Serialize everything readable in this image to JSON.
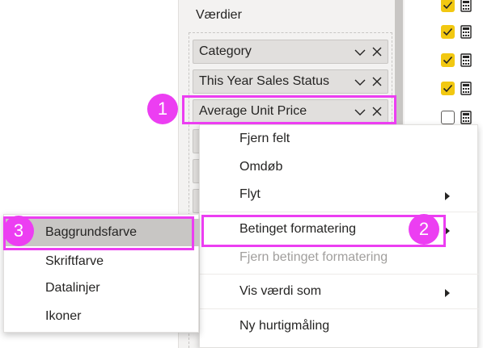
{
  "fields_pane": {
    "title": "Værdier",
    "fields": [
      {
        "label": "Category"
      },
      {
        "label": "This Year Sales Status"
      },
      {
        "label": "Average Unit Price"
      }
    ]
  },
  "context_menu": {
    "items": [
      {
        "label": "Fjern felt",
        "enabled": true,
        "submenu": false
      },
      {
        "label": "Omdøb",
        "enabled": true,
        "submenu": false
      },
      {
        "label": "Flyt",
        "enabled": true,
        "submenu": true
      },
      {
        "label": "Betinget formatering",
        "enabled": true,
        "submenu": true
      },
      {
        "label": "Fjern betinget formatering",
        "enabled": false,
        "submenu": false
      },
      {
        "label": "Vis værdi som",
        "enabled": true,
        "submenu": true
      },
      {
        "label": "Ny hurtigmåling",
        "enabled": true,
        "submenu": false
      }
    ]
  },
  "submenu": {
    "items": [
      {
        "label": "Baggrundsfarve",
        "selected": true
      },
      {
        "label": "Skriftfarve",
        "selected": false
      },
      {
        "label": "Datalinjer",
        "selected": false
      },
      {
        "label": "Ikoner",
        "selected": false
      }
    ]
  },
  "callouts": {
    "one": "1",
    "two": "2",
    "three": "3"
  },
  "colors": {
    "accent_highlight": "#ec3ef2",
    "checkbox_checked": "#f2c811",
    "menu_selected": "#c8c6c4"
  },
  "icons": {
    "field_dropdown": "chevron-down-icon",
    "field_remove": "close-icon",
    "submenu_arrow": "caret-right-icon",
    "field_type": "calculator-icon"
  }
}
